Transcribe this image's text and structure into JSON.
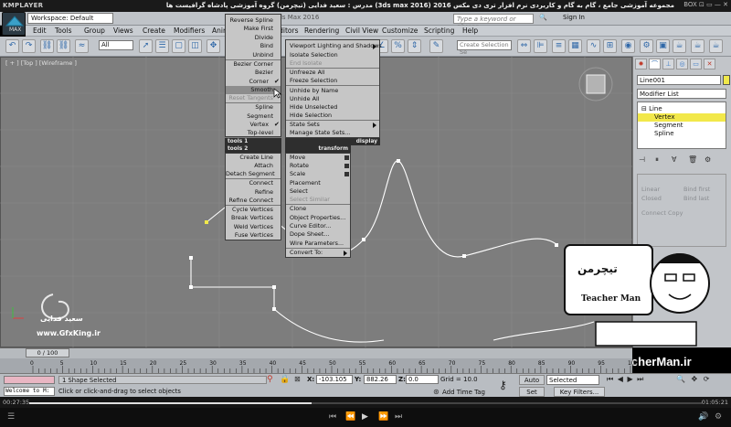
{
  "player": {
    "logo": "KMPLAYER",
    "title": "مجموعه آموزشی جامع ، گام به گام و کاربردی نرم افزار تری دی مکس 2016 (3ds max 2016) مدرس : سعید فدایی (تیچرمن) گروه آموزشی پادشاه گرافیست ها",
    "window_controls": "BOX ⊡ ▭ — ✕",
    "time_elapsed": "00:27:35",
    "time_total": "01:05:21",
    "progress_percent": 42
  },
  "max": {
    "logo": "MAX",
    "workspace": "Workspace: Default",
    "title": "3ds Max 2016",
    "search_placeholder": "Type a keyword or phrase",
    "sign_in": "Sign In",
    "menu": [
      "Edit",
      "Tools",
      "Group",
      "Views",
      "Create",
      "Modifiers",
      "Animation",
      "Graph Editors",
      "Rendering",
      "Civil View",
      "Customize",
      "Scripting",
      "Help"
    ],
    "selection_filter": "All",
    "selection_set": "Create Selection Se",
    "viewport_label": "[ + ] [Top ] [Wireframe ]"
  },
  "quad": {
    "top_left_items": [
      {
        "label": "Reverse Spline"
      },
      {
        "label": "Make First"
      },
      {
        "label": "Divide"
      },
      {
        "label": "Bind"
      },
      {
        "label": "Unbind"
      },
      {
        "label": "Bezier Corner"
      },
      {
        "label": "Bezier"
      },
      {
        "label": "Corner",
        "check": true
      },
      {
        "label": "Smooth",
        "highlight": true
      },
      {
        "label": "Reset Tangents",
        "disabled": true
      },
      {
        "label": "Spline"
      },
      {
        "label": "Segment"
      },
      {
        "label": "Vertex",
        "check": true
      },
      {
        "label": "Top-level"
      }
    ],
    "top_right_items": [
      {
        "label": "Viewport Lighting and Shadows",
        "arrow": true
      },
      {
        "label": "Isolate Selection"
      },
      {
        "label": "End Isolate",
        "disabled": true
      },
      {
        "label": "Unfreeze All"
      },
      {
        "label": "Freeze Selection"
      },
      {
        "label": "Unhide by Name"
      },
      {
        "label": "Unhide All"
      },
      {
        "label": "Hide Unselected"
      },
      {
        "label": "Hide Selection"
      },
      {
        "label": "State Sets",
        "arrow": true
      },
      {
        "label": "Manage State Sets..."
      }
    ],
    "header_tools1": "tools 1",
    "header_display": "display",
    "header_tools2": "tools 2",
    "header_transform": "transform",
    "bottom_left_items": [
      {
        "label": "Create Line"
      },
      {
        "label": "Attach"
      },
      {
        "label": "Detach Segment"
      },
      {
        "label": "Connect"
      },
      {
        "label": "Refine"
      },
      {
        "label": "Refine Connect"
      },
      {
        "label": "Cycle Vertices"
      },
      {
        "label": "Break Vertices"
      },
      {
        "label": "Weld Vertices"
      },
      {
        "label": "Fuse Vertices"
      }
    ],
    "bottom_right_items": [
      {
        "label": "Move",
        "box": true
      },
      {
        "label": "Rotate",
        "box": true
      },
      {
        "label": "Scale",
        "box": true
      },
      {
        "label": "Placement"
      },
      {
        "label": "Select"
      },
      {
        "label": "Select Similar",
        "disabled": true
      },
      {
        "label": "Clone"
      },
      {
        "label": "Object Properties..."
      },
      {
        "label": "Curve Editor..."
      },
      {
        "label": "Dope Sheet..."
      },
      {
        "label": "Wire Parameters..."
      },
      {
        "label": "Convert To:",
        "arrow": true
      }
    ]
  },
  "command_panel": {
    "object_name": "Line001",
    "modifier_list": "Modifier List",
    "stack": [
      {
        "label": "⊟ Line",
        "indent": 0
      },
      {
        "label": "Vertex",
        "indent": 2,
        "selected": true
      },
      {
        "label": "Segment",
        "indent": 2
      },
      {
        "label": "Spline",
        "indent": 2
      }
    ],
    "rollout": [
      "Linear",
      "Closed",
      "Bind first",
      "Bind last",
      "Connect Copy"
    ],
    "object_color": "#f0e84a"
  },
  "timeline": {
    "frame_indicator": "0 / 100",
    "ticks": [
      "0",
      "5",
      "10",
      "15",
      "20",
      "25",
      "30",
      "35",
      "40",
      "45",
      "50",
      "55",
      "60",
      "65",
      "70",
      "75",
      "80",
      "85",
      "90",
      "95",
      "100"
    ]
  },
  "status": {
    "listener": "Welcome to M:",
    "selection": "1 Shape Selected",
    "prompt": "Click or click-and-drag to select objects",
    "x_label": "X:",
    "x_value": "-103.105",
    "y_label": "Y:",
    "y_value": "882.26",
    "z_label": "Z:",
    "z_value": "0.0",
    "grid": "Grid = 10.0",
    "add_time_tag": "Add Time Tag",
    "auto_key": "Auto Key",
    "set_key": "Set Key",
    "selected": "Selected",
    "key_filters": "Key Filters..."
  },
  "watermark": {
    "url": "www.TeacherMan.ir",
    "badge_text": "Teacher Man",
    "badge_fa": "تیچرمن",
    "gfx_site": "www.GfxKing.ir",
    "gfx_author": "سعید فدایی"
  }
}
